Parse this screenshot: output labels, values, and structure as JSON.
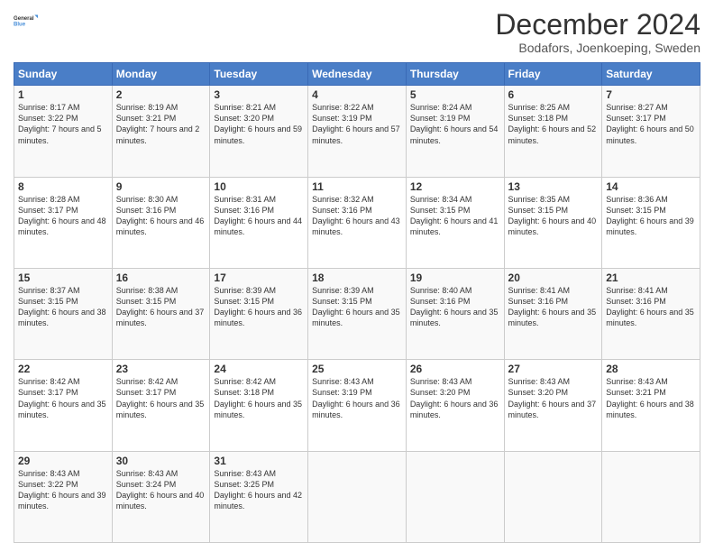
{
  "header": {
    "logo_line1": "General",
    "logo_line2": "Blue",
    "month_title": "December 2024",
    "location": "Bodafors, Joenkoeping, Sweden"
  },
  "weekdays": [
    "Sunday",
    "Monday",
    "Tuesday",
    "Wednesday",
    "Thursday",
    "Friday",
    "Saturday"
  ],
  "weeks": [
    [
      {
        "day": "1",
        "sunrise": "8:17 AM",
        "sunset": "3:22 PM",
        "daylight": "7 hours and 5 minutes."
      },
      {
        "day": "2",
        "sunrise": "8:19 AM",
        "sunset": "3:21 PM",
        "daylight": "7 hours and 2 minutes."
      },
      {
        "day": "3",
        "sunrise": "8:21 AM",
        "sunset": "3:20 PM",
        "daylight": "6 hours and 59 minutes."
      },
      {
        "day": "4",
        "sunrise": "8:22 AM",
        "sunset": "3:19 PM",
        "daylight": "6 hours and 57 minutes."
      },
      {
        "day": "5",
        "sunrise": "8:24 AM",
        "sunset": "3:19 PM",
        "daylight": "6 hours and 54 minutes."
      },
      {
        "day": "6",
        "sunrise": "8:25 AM",
        "sunset": "3:18 PM",
        "daylight": "6 hours and 52 minutes."
      },
      {
        "day": "7",
        "sunrise": "8:27 AM",
        "sunset": "3:17 PM",
        "daylight": "6 hours and 50 minutes."
      }
    ],
    [
      {
        "day": "8",
        "sunrise": "8:28 AM",
        "sunset": "3:17 PM",
        "daylight": "6 hours and 48 minutes."
      },
      {
        "day": "9",
        "sunrise": "8:30 AM",
        "sunset": "3:16 PM",
        "daylight": "6 hours and 46 minutes."
      },
      {
        "day": "10",
        "sunrise": "8:31 AM",
        "sunset": "3:16 PM",
        "daylight": "6 hours and 44 minutes."
      },
      {
        "day": "11",
        "sunrise": "8:32 AM",
        "sunset": "3:16 PM",
        "daylight": "6 hours and 43 minutes."
      },
      {
        "day": "12",
        "sunrise": "8:34 AM",
        "sunset": "3:15 PM",
        "daylight": "6 hours and 41 minutes."
      },
      {
        "day": "13",
        "sunrise": "8:35 AM",
        "sunset": "3:15 PM",
        "daylight": "6 hours and 40 minutes."
      },
      {
        "day": "14",
        "sunrise": "8:36 AM",
        "sunset": "3:15 PM",
        "daylight": "6 hours and 39 minutes."
      }
    ],
    [
      {
        "day": "15",
        "sunrise": "8:37 AM",
        "sunset": "3:15 PM",
        "daylight": "6 hours and 38 minutes."
      },
      {
        "day": "16",
        "sunrise": "8:38 AM",
        "sunset": "3:15 PM",
        "daylight": "6 hours and 37 minutes."
      },
      {
        "day": "17",
        "sunrise": "8:39 AM",
        "sunset": "3:15 PM",
        "daylight": "6 hours and 36 minutes."
      },
      {
        "day": "18",
        "sunrise": "8:39 AM",
        "sunset": "3:15 PM",
        "daylight": "6 hours and 35 minutes."
      },
      {
        "day": "19",
        "sunrise": "8:40 AM",
        "sunset": "3:16 PM",
        "daylight": "6 hours and 35 minutes."
      },
      {
        "day": "20",
        "sunrise": "8:41 AM",
        "sunset": "3:16 PM",
        "daylight": "6 hours and 35 minutes."
      },
      {
        "day": "21",
        "sunrise": "8:41 AM",
        "sunset": "3:16 PM",
        "daylight": "6 hours and 35 minutes."
      }
    ],
    [
      {
        "day": "22",
        "sunrise": "8:42 AM",
        "sunset": "3:17 PM",
        "daylight": "6 hours and 35 minutes."
      },
      {
        "day": "23",
        "sunrise": "8:42 AM",
        "sunset": "3:17 PM",
        "daylight": "6 hours and 35 minutes."
      },
      {
        "day": "24",
        "sunrise": "8:42 AM",
        "sunset": "3:18 PM",
        "daylight": "6 hours and 35 minutes."
      },
      {
        "day": "25",
        "sunrise": "8:43 AM",
        "sunset": "3:19 PM",
        "daylight": "6 hours and 36 minutes."
      },
      {
        "day": "26",
        "sunrise": "8:43 AM",
        "sunset": "3:20 PM",
        "daylight": "6 hours and 36 minutes."
      },
      {
        "day": "27",
        "sunrise": "8:43 AM",
        "sunset": "3:20 PM",
        "daylight": "6 hours and 37 minutes."
      },
      {
        "day": "28",
        "sunrise": "8:43 AM",
        "sunset": "3:21 PM",
        "daylight": "6 hours and 38 minutes."
      }
    ],
    [
      {
        "day": "29",
        "sunrise": "8:43 AM",
        "sunset": "3:22 PM",
        "daylight": "6 hours and 39 minutes."
      },
      {
        "day": "30",
        "sunrise": "8:43 AM",
        "sunset": "3:24 PM",
        "daylight": "6 hours and 40 minutes."
      },
      {
        "day": "31",
        "sunrise": "8:43 AM",
        "sunset": "3:25 PM",
        "daylight": "6 hours and 42 minutes."
      },
      null,
      null,
      null,
      null
    ]
  ]
}
